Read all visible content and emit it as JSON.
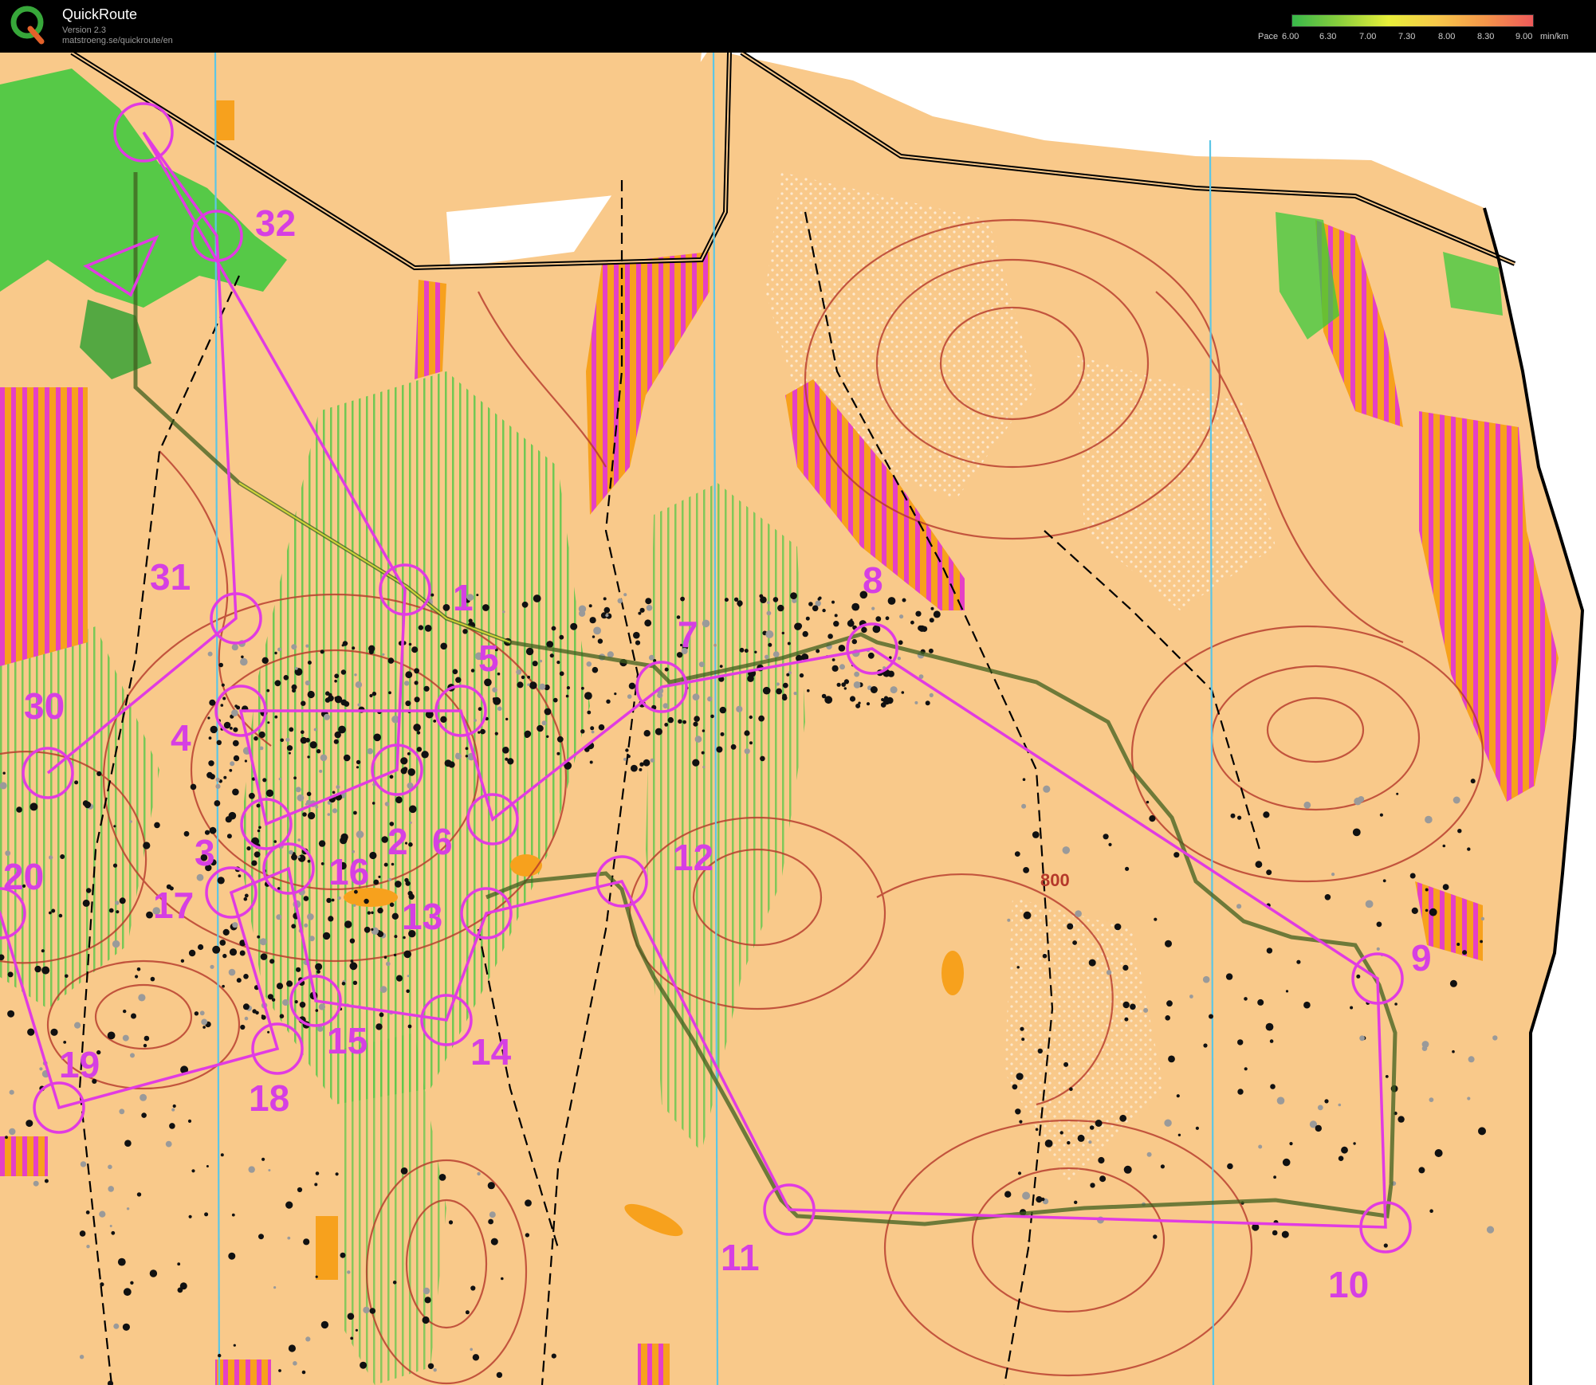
{
  "app": {
    "name": "QuickRoute",
    "version": "Version 2.3",
    "url": "matstroeng.se/quickroute/en"
  },
  "pace_legend": {
    "title": "Pace",
    "unit": "min/km",
    "ticks": [
      "6.00",
      "6.30",
      "7.00",
      "7.30",
      "8.00",
      "8.30",
      "9.00"
    ],
    "gradient_colors": [
      "#38b84a",
      "#8ccf3c",
      "#e8ef3a",
      "#f7c84a",
      "#f4964a",
      "#ee5a5a"
    ]
  },
  "map": {
    "colors": {
      "terrain": "#f9c98a",
      "forbidden_stripe": "#e540c6",
      "forbidden_base": "#f7a11d",
      "course": "#e13be2",
      "route_track": "#5c7a2e",
      "contour": "#b5382a",
      "green_vegetation": "#39c93b",
      "magnetic_north": "#5cc6e6",
      "outside": "#ffffff"
    },
    "contour_label": "800",
    "controls": [
      {
        "num": "1"
      },
      {
        "num": "2"
      },
      {
        "num": "3"
      },
      {
        "num": "4"
      },
      {
        "num": "5"
      },
      {
        "num": "6"
      },
      {
        "num": "7"
      },
      {
        "num": "8"
      },
      {
        "num": "9"
      },
      {
        "num": "10"
      },
      {
        "num": "11"
      },
      {
        "num": "12"
      },
      {
        "num": "13"
      },
      {
        "num": "14"
      },
      {
        "num": "15"
      },
      {
        "num": "16"
      },
      {
        "num": "17"
      },
      {
        "num": "18"
      },
      {
        "num": "19"
      },
      {
        "num": "20"
      },
      {
        "num": "30"
      },
      {
        "num": "31"
      },
      {
        "num": "32"
      }
    ]
  }
}
